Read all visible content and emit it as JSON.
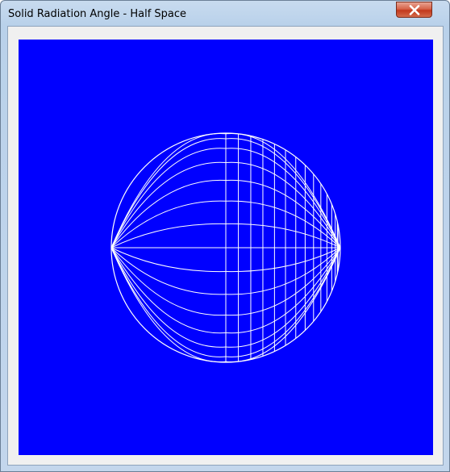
{
  "window": {
    "title": "Solid Radiation Angle - Half Space"
  },
  "titlebar_buttons": {
    "close_icon": "x-icon"
  },
  "canvas": {
    "background_color": "#0000ff",
    "line_color": "#ffffff",
    "figure": "hemisphere-wireframe"
  }
}
